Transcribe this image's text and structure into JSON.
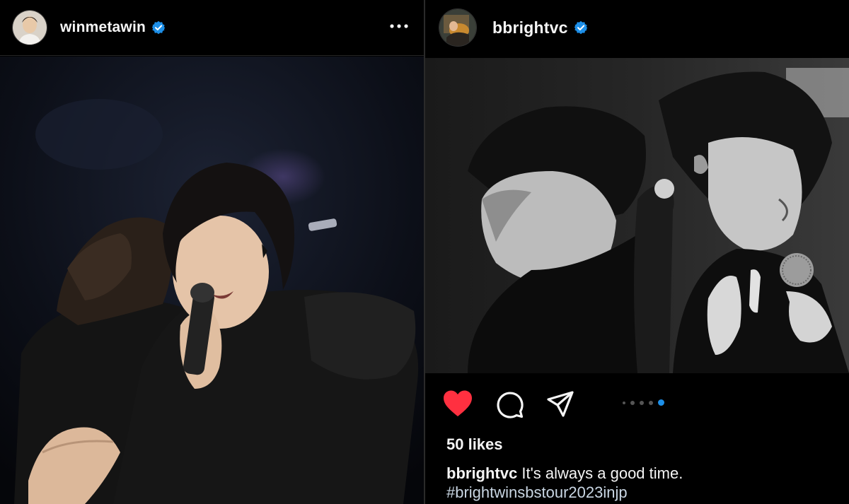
{
  "left_post": {
    "username": "winmetawin",
    "verified": true,
    "avatar_icon": "profile-avatar",
    "more_icon": "more-options-icon"
  },
  "right_post": {
    "username": "bbrightvc",
    "verified": true,
    "avatar_icon": "profile-avatar",
    "likes": "50 likes",
    "caption_user": "bbrightvc",
    "caption_text": "It's always a good time.",
    "hashtag": "#brightwinsbstour2023injp",
    "liked": true,
    "carousel": {
      "count": 5,
      "active_index": 4
    },
    "actions": [
      "heart-icon",
      "comment-icon",
      "share-icon"
    ]
  },
  "colors": {
    "background": "#000000",
    "like_red": "#ff3040",
    "verified_blue": "#1d8fe8",
    "hashtag": "#c9d6e3"
  }
}
